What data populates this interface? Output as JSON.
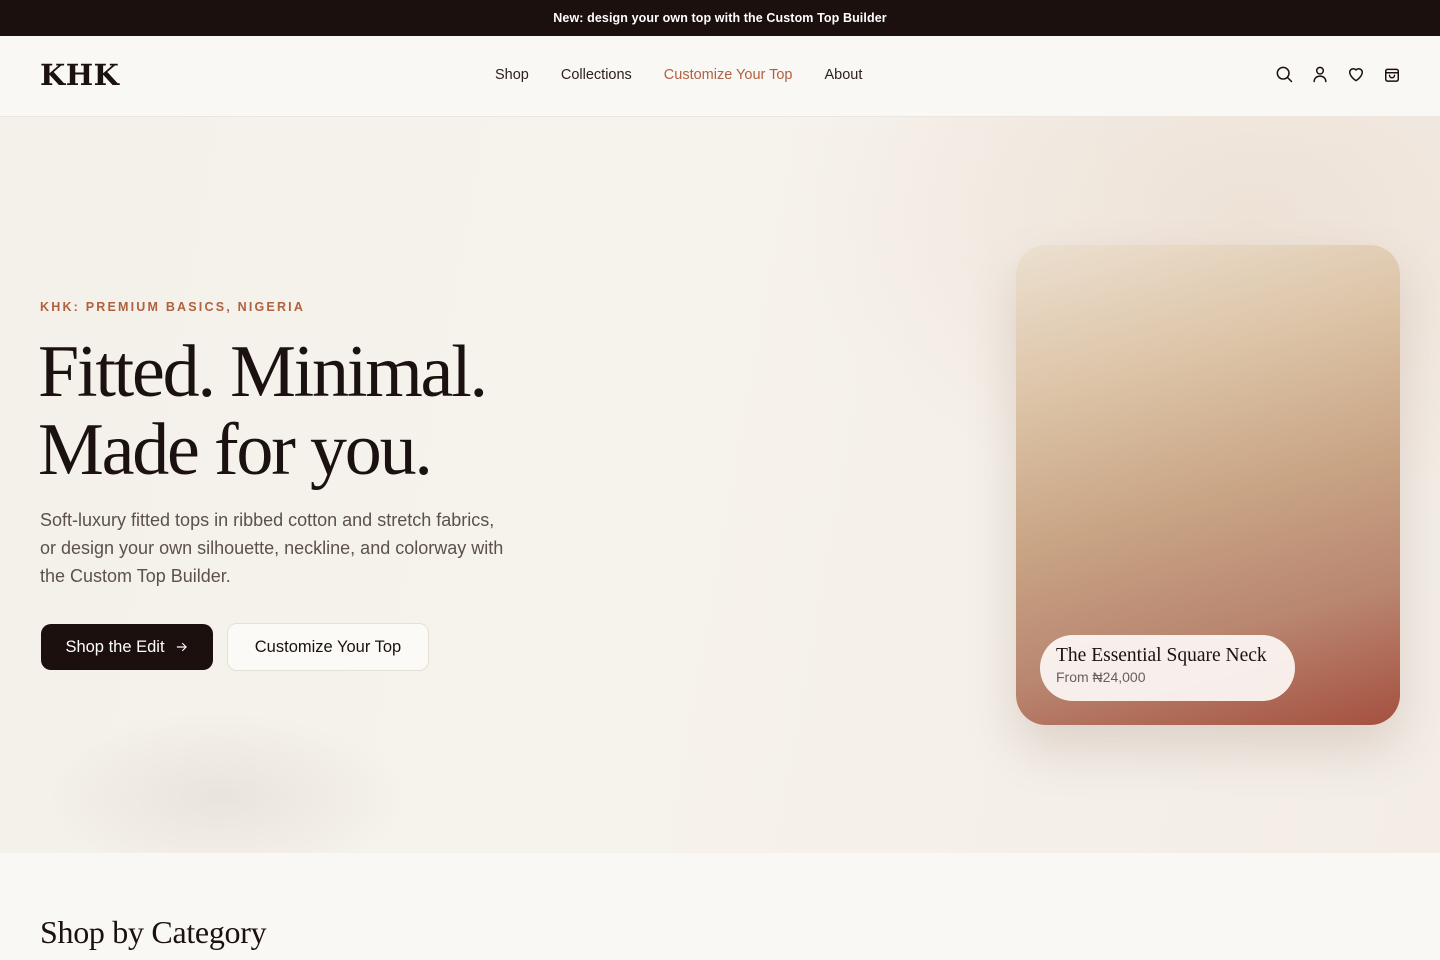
{
  "announcement": {
    "text": "New: design your own top with the Custom Top Builder"
  },
  "header": {
    "logo": "KHK",
    "nav": [
      {
        "label": "Shop",
        "active": false
      },
      {
        "label": "Collections",
        "active": false
      },
      {
        "label": "Customize Your Top",
        "active": true
      },
      {
        "label": "About",
        "active": false
      }
    ],
    "icons": [
      "search-icon",
      "account-icon",
      "wishlist-icon",
      "cart-icon"
    ]
  },
  "hero": {
    "eyebrow": "KHK: PREMIUM BASICS, NIGERIA",
    "headline_line1": "Fitted. Minimal.",
    "headline_line2": "Made for you.",
    "lede": "Soft-luxury fitted tops in ribbed cotton and stretch fabrics, or design your own silhouette, neckline, and colorway with the Custom Top Builder.",
    "primary_cta": "Shop the Edit",
    "secondary_cta": "Customize Your Top",
    "card": {
      "product_name": "The Essential Square Neck",
      "price": "From ₦24,000"
    }
  },
  "categories": {
    "title": "Shop by Category"
  },
  "colors": {
    "accent": "#b0613f",
    "dark": "#1b100d",
    "background": "#faf8f5"
  }
}
